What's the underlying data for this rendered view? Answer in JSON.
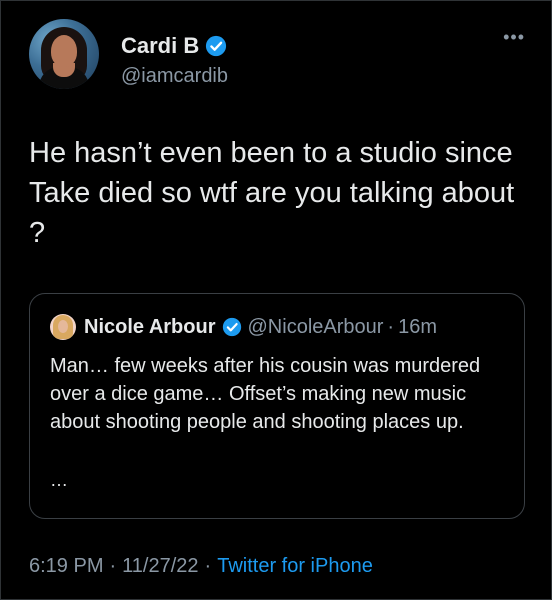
{
  "author": {
    "display_name": "Cardi B",
    "handle": "@iamcardib"
  },
  "more_menu": "•••",
  "tweet": {
    "text": "He hasn’t even been to a studio since Take died so wtf are you talking about ?"
  },
  "quoted_tweet": {
    "display_name": "Nicole Arbour",
    "handle": "@NicoleArbour",
    "separator": "·",
    "time": "16m",
    "text": "Man… few weeks after his cousin was murdered over a dice game… Offset’s making new music about shooting people and shooting places up.",
    "truncation": "…"
  },
  "meta": {
    "time": "6:19 PM",
    "date": "11/27/22",
    "separator": "·",
    "source": "Twitter for iPhone"
  },
  "colors": {
    "background": "#000000",
    "text": "#e7e9ea",
    "secondary": "#8b98a5",
    "accent": "#1d9bf0"
  }
}
